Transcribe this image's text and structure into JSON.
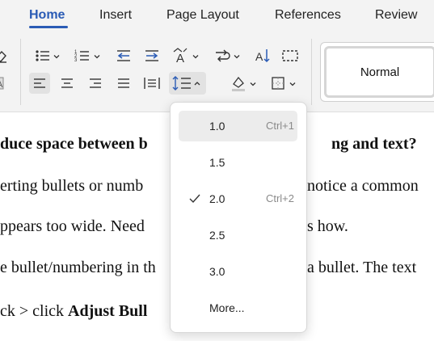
{
  "tabs": [
    {
      "label": "Home",
      "active": true
    },
    {
      "label": "Insert",
      "active": false
    },
    {
      "label": "Page Layout",
      "active": false
    },
    {
      "label": "References",
      "active": false
    },
    {
      "label": "Review",
      "active": false
    }
  ],
  "styles": {
    "normal_label": "Normal"
  },
  "ribbon_icons": [
    "bullet-list-icon",
    "numbered-list-icon",
    "decrease-indent-icon",
    "increase-indent-icon",
    "change-case-icon",
    "text-direction-icon",
    "sort-icon",
    "show-marks-icon",
    "align-left-icon",
    "align-center-icon",
    "align-right-icon",
    "justify-icon",
    "distributed-icon",
    "line-spacing-icon",
    "shading-icon",
    "borders-icon"
  ],
  "document": {
    "lines": [
      {
        "a": "duce space between b",
        "b": "ng and text?",
        "bold": true
      },
      {
        "a": "erting bullets or numb",
        "b": "notice a common",
        "bold": false
      },
      {
        "a": "ppears too wide. Need",
        "b": "s how.",
        "bold": false
      },
      {
        "a": "e bullet/numbering in th",
        "b": "a bullet. The text",
        "bold": false
      },
      {
        "a": "ck > click ",
        "a_bold": "Adjust Bull",
        "b": "",
        "bold": false
      }
    ]
  },
  "line_spacing_menu": {
    "items": [
      {
        "label": "1.0",
        "shortcut": "Ctrl+1",
        "checked": false,
        "hovered": true
      },
      {
        "label": "1.5",
        "shortcut": "",
        "checked": false,
        "hovered": false
      },
      {
        "label": "2.0",
        "shortcut": "Ctrl+2",
        "checked": true,
        "hovered": false
      },
      {
        "label": "2.5",
        "shortcut": "",
        "checked": false,
        "hovered": false
      },
      {
        "label": "3.0",
        "shortcut": "",
        "checked": false,
        "hovered": false
      },
      {
        "label": "More...",
        "shortcut": "",
        "checked": false,
        "hovered": false
      }
    ]
  },
  "colors": {
    "accent": "#2a5bb5",
    "ribbon_bg": "#f3f3f3",
    "hover_bg": "#ececec"
  }
}
